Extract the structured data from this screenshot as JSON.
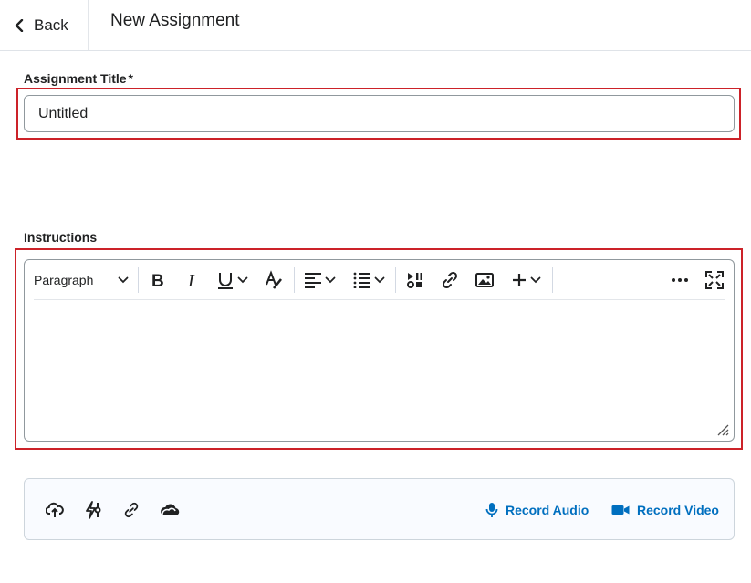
{
  "header": {
    "back_label": "Back",
    "title": "New Assignment"
  },
  "assignment_title": {
    "label": "Assignment Title",
    "required_marker": "*",
    "value": "Untitled"
  },
  "instructions": {
    "label": "Instructions",
    "toolbar": {
      "format_select": "Paragraph",
      "buttons": [
        "bold-icon",
        "italic-icon",
        "underline-icon",
        "text-color-icon",
        "align-icon",
        "list-icon",
        "media-icon",
        "link-icon",
        "image-icon",
        "insert-icon",
        "more-icon",
        "fullscreen-icon"
      ]
    },
    "body": ""
  },
  "attachments": {
    "icons": [
      "upload-icon",
      "activity-icon",
      "link-icon",
      "cloud-icon"
    ],
    "record_audio": "Record Audio",
    "record_video": "Record Video"
  },
  "colors": {
    "highlight": "#cc2229",
    "accent": "#006fbf",
    "text": "#202122"
  }
}
